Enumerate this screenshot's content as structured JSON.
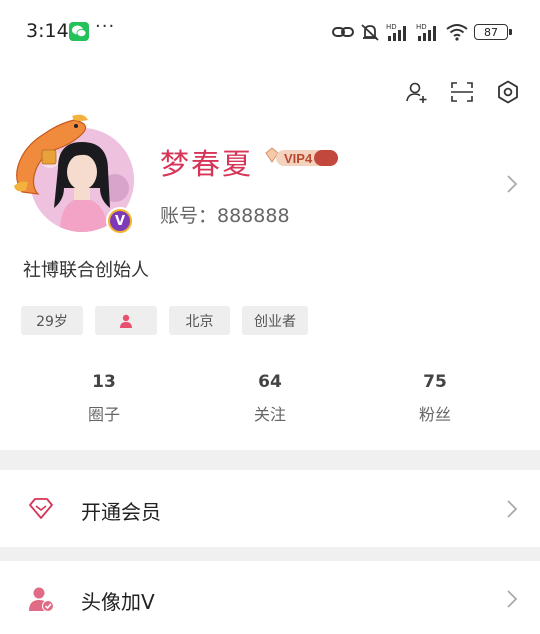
{
  "status_bar": {
    "time": "3:14",
    "more": "···",
    "battery": "87",
    "icons": [
      "wechat-icon",
      "link-icon",
      "mute-icon",
      "signal-hd-icon",
      "signal-hd-icon",
      "wifi-icon",
      "battery-icon"
    ]
  },
  "top_actions": [
    "add-friend-icon",
    "scan-icon",
    "settings-icon"
  ],
  "profile": {
    "name": "梦春夏",
    "vip_level": "VIP4",
    "account": "账号：888888",
    "bio": "社博联合创始人",
    "avatar_badge": "V"
  },
  "tags": {
    "age": "29岁",
    "gender_icon": "female-icon",
    "city": "北京",
    "job": "创业者"
  },
  "stats": [
    {
      "value": "13",
      "label": "圈子"
    },
    {
      "value": "64",
      "label": "关注"
    },
    {
      "value": "75",
      "label": "粉丝"
    }
  ],
  "menu": [
    {
      "label": "开通会员",
      "icon": "diamond-icon"
    },
    {
      "label": "头像加V",
      "icon": "user-verify-icon"
    }
  ],
  "colors": {
    "accent": "#d63557",
    "tag_bg": "#eeeeee",
    "divider": "#f0f0f0"
  }
}
